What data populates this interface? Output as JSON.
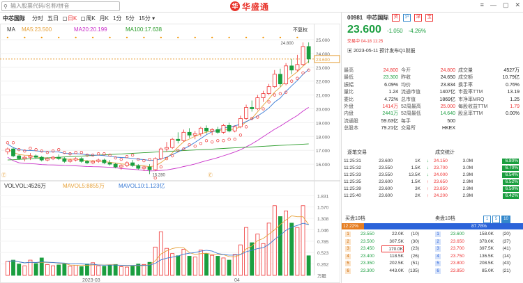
{
  "header": {
    "search_placeholder": "输入股票代码/名称/拼音",
    "logo_mark": "华",
    "logo_text": "华盛通",
    "win": [
      "≡",
      "—",
      "▢",
      "✕"
    ]
  },
  "toolbar": {
    "name": "中芯国际",
    "periods": [
      "分时",
      "五日",
      "日K",
      "周K",
      "月K",
      "1分",
      "5分",
      "15分"
    ],
    "selected": "日K",
    "ma_label": "MA",
    "ma5": "MA5:23.500",
    "ma20": "MA20:20.199",
    "ma100": "MA100:17.638",
    "adjust": "不复权"
  },
  "chart": {
    "price_ticks": [
      "25.000",
      "24.000",
      "23.000",
      "22.000",
      "21.000",
      "20.000",
      "19.000",
      "18.000",
      "17.000",
      "16.000"
    ],
    "last_price_label": "23.600",
    "high_label": "24.800",
    "low_label": "15.280",
    "vol_label": "VOL",
    "vol": "VOL:4526万",
    "mavol5": "MAVOL5:8855万",
    "mavol10": "MAVOL10:1.123亿",
    "vol_ticks": [
      "1.831",
      "1.570",
      "1.308",
      "1.046",
      "0.785",
      "0.523",
      "0.262",
      "万股"
    ],
    "x_labels": [
      "2023-03",
      "04"
    ],
    "candles": [
      [
        16.9,
        17.2,
        16.7,
        17.1
      ],
      [
        17.1,
        17.2,
        16.5,
        16.6
      ],
      [
        16.6,
        16.7,
        16.3,
        16.4
      ],
      [
        16.4,
        16.6,
        16.2,
        16.5
      ],
      [
        16.5,
        16.8,
        16.3,
        16.6
      ],
      [
        16.6,
        16.7,
        16.4,
        16.5
      ],
      [
        16.5,
        16.6,
        16.2,
        16.3
      ],
      [
        16.3,
        16.5,
        16.2,
        16.4
      ],
      [
        16.4,
        16.6,
        16.3,
        16.5
      ],
      [
        16.5,
        16.7,
        16.3,
        16.4
      ],
      [
        16.4,
        16.5,
        16.1,
        16.2
      ],
      [
        16.2,
        16.4,
        16.1,
        16.3
      ],
      [
        16.3,
        16.5,
        16.2,
        16.4
      ],
      [
        16.4,
        16.5,
        16.1,
        16.2
      ],
      [
        16.2,
        16.3,
        16.0,
        16.1
      ],
      [
        16.1,
        16.3,
        16.0,
        16.2
      ],
      [
        16.2,
        16.4,
        16.1,
        16.3
      ],
      [
        16.3,
        16.4,
        16.0,
        16.1
      ],
      [
        16.1,
        16.3,
        15.9,
        16.0
      ],
      [
        16.0,
        16.1,
        15.7,
        15.8
      ],
      [
        15.8,
        16.0,
        15.6,
        15.9
      ],
      [
        15.9,
        16.2,
        15.8,
        16.1
      ],
      [
        16.1,
        16.3,
        15.8,
        15.9
      ],
      [
        15.9,
        16.0,
        15.6,
        15.7
      ],
      [
        15.7,
        15.9,
        15.5,
        15.8
      ],
      [
        15.8,
        16.0,
        15.28,
        15.6
      ],
      [
        15.6,
        16.5,
        15.5,
        16.4
      ],
      [
        16.4,
        17.2,
        16.3,
        17.1
      ],
      [
        17.1,
        17.6,
        16.9,
        17.2
      ],
      [
        17.2,
        17.9,
        17.1,
        17.8
      ],
      [
        17.8,
        18.3,
        17.5,
        17.7
      ],
      [
        17.7,
        18.5,
        17.6,
        18.3
      ],
      [
        18.3,
        18.6,
        17.9,
        18.1
      ],
      [
        18.1,
        18.4,
        17.8,
        18.2
      ],
      [
        18.2,
        18.7,
        18.0,
        18.6
      ],
      [
        18.6,
        18.8,
        18.2,
        18.4
      ],
      [
        18.4,
        18.6,
        18.1,
        18.5
      ],
      [
        18.5,
        18.7,
        18.2,
        18.3
      ],
      [
        18.3,
        18.9,
        18.2,
        18.8
      ],
      [
        18.8,
        19.0,
        18.3,
        18.4
      ],
      [
        18.4,
        18.8,
        18.3,
        18.7
      ],
      [
        18.7,
        19.5,
        18.6,
        19.3
      ],
      [
        19.3,
        20.3,
        19.2,
        20.1
      ],
      [
        20.1,
        20.6,
        19.8,
        20.0
      ],
      [
        20.0,
        21.0,
        19.9,
        20.8
      ],
      [
        20.8,
        21.3,
        20.5,
        21.1
      ],
      [
        21.1,
        21.8,
        21.0,
        21.6
      ],
      [
        21.6,
        22.8,
        21.5,
        22.5
      ],
      [
        22.5,
        22.9,
        21.6,
        21.8
      ],
      [
        21.8,
        23.3,
        21.7,
        23.1
      ],
      [
        23.1,
        23.6,
        22.5,
        22.8
      ],
      [
        22.8,
        23.9,
        22.7,
        23.2
      ],
      [
        23.2,
        24.8,
        23.1,
        24.5
      ],
      [
        24.5,
        24.8,
        23.3,
        23.6
      ]
    ],
    "volumes": [
      0.32,
      0.35,
      0.26,
      0.22,
      0.35,
      0.27,
      0.4,
      0.25,
      0.22,
      0.24,
      0.26,
      0.21,
      0.23,
      0.2,
      0.26,
      0.29,
      0.22,
      0.21,
      0.24,
      0.25,
      0.2,
      0.19,
      0.22,
      0.26,
      0.25,
      0.3,
      0.65,
      1.0,
      0.62,
      0.5,
      0.45,
      0.6,
      0.44,
      0.42,
      0.58,
      0.5,
      0.46,
      0.44,
      0.4,
      0.35,
      0.48,
      0.7,
      1.1,
      0.75,
      0.95,
      0.73,
      1.2,
      1.6,
      1.35,
      1.48,
      1.2,
      1.1,
      1.6,
      0.45
    ]
  },
  "quote": {
    "code": "00981",
    "name": "中芯国际",
    "tags": [
      "资",
      "沪",
      "深",
      "宝"
    ],
    "price": "23.600",
    "change": "-1.050",
    "pct": "-4.26%",
    "trade_time": "交易中 04-18 11:25",
    "notice": "2023-05-11 预计发布Q1财报",
    "rows": [
      [
        "最高",
        "24.800",
        "今开",
        "24.800",
        "成交量",
        "4527万"
      ],
      [
        "最低",
        "23.300",
        "昨收",
        "24.650",
        "成交额",
        "10.79亿"
      ],
      [
        "振幅",
        "6.09%",
        "均价",
        "23.834",
        "换手率",
        "0.76%"
      ],
      [
        "量比",
        "1.24",
        "流通市值",
        "1407亿",
        "市盈率TTM",
        "13.19"
      ],
      [
        "委比",
        "4.72%",
        "总市值",
        "1869亿",
        "市净率MRQ",
        "1.25"
      ],
      [
        "外盘",
        "1414万",
        "52周最高",
        "25.000",
        "每股收益TTM",
        "1.79"
      ],
      [
        "内盘",
        "2441万",
        "52周最低",
        "14.640",
        "股息率TTM",
        "0.00%"
      ],
      [
        "流通股",
        "59.63亿",
        "每手",
        "500",
        "",
        ""
      ],
      [
        "总股本",
        "79.21亿",
        "交易所",
        "HKEX",
        "",
        ""
      ]
    ]
  },
  "tape": {
    "left_title": "逐笔交易",
    "right_title": "成交统计",
    "left": [
      [
        "11:25:31",
        "23.600",
        "1K",
        "down"
      ],
      [
        "11:25:32",
        "23.550",
        "1.5K",
        "down"
      ],
      [
        "11:25:33",
        "23.550",
        "13.5K",
        "down"
      ],
      [
        "11:25:35",
        "23.600",
        "1.5K",
        "up"
      ],
      [
        "11:25:39",
        "23.600",
        "3K",
        "up"
      ],
      [
        "11:25:40",
        "23.600",
        "2K",
        "up"
      ]
    ],
    "right": [
      [
        "24.150",
        "3.0M",
        "6.80%"
      ],
      [
        "23.700",
        "3.0M",
        "6.70%"
      ],
      [
        "24.000",
        "2.9M",
        "6.54%"
      ],
      [
        "23.650",
        "2.9M",
        "6.52%"
      ],
      [
        "23.850",
        "2.9M",
        "6.50%"
      ],
      [
        "24.200",
        "2.9M",
        "6.42%"
      ]
    ]
  },
  "book": {
    "bid_title": "买盘10档",
    "ask_title": "卖盘10档",
    "bid_pct": "12.22%",
    "ask_pct": "87.78%",
    "levels": [
      "1",
      "5",
      "10"
    ],
    "bids": [
      [
        "1",
        "23.550",
        "22.0K",
        "(10)"
      ],
      [
        "2",
        "23.500",
        "307.5K",
        "(30)"
      ],
      [
        "3",
        "23.450",
        "170.0K",
        "(23)"
      ],
      [
        "4",
        "23.400",
        "118.5K",
        "(26)"
      ],
      [
        "5",
        "23.350",
        "202.5K",
        "(51)"
      ],
      [
        "6",
        "23.300",
        "443.0K",
        "(135)"
      ]
    ],
    "asks": [
      [
        "1",
        "23.600",
        "158.0K",
        "(20)"
      ],
      [
        "2",
        "23.650",
        "378.0K",
        "(37)"
      ],
      [
        "3",
        "23.700",
        "397.5K",
        "(41)"
      ],
      [
        "4",
        "23.750",
        "136.5K",
        "(14)"
      ],
      [
        "5",
        "23.800",
        "208.5K",
        "(43)"
      ],
      [
        "6",
        "23.850",
        "85.0K",
        "(21)"
      ]
    ]
  }
}
